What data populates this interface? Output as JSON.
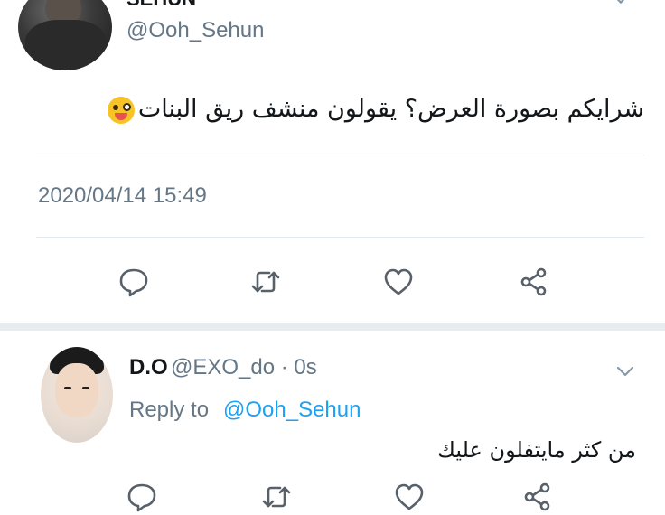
{
  "top_tweet": {
    "author_name": "SEHUN",
    "handle": "@Ooh_Sehun",
    "text": "شرايكم بصورة العرض؟ يقولون منشف ريق البنات",
    "timestamp": "2020/04/14 15:49"
  },
  "reply": {
    "author_name": "D.O",
    "handle_time": "@EXO_do · 0s",
    "reply_to_label": "Reply to",
    "reply_to_handle": "@Ooh_Sehun",
    "text": "من كثر مايتفلون عليك"
  },
  "icons": [
    "reply-icon",
    "retweet-icon",
    "like-icon",
    "share-icon",
    "chevron-down-icon"
  ],
  "colors": {
    "text": "#14171a",
    "secondary": "#657786",
    "link": "#1da1f2",
    "divider": "#e1e8ed"
  }
}
